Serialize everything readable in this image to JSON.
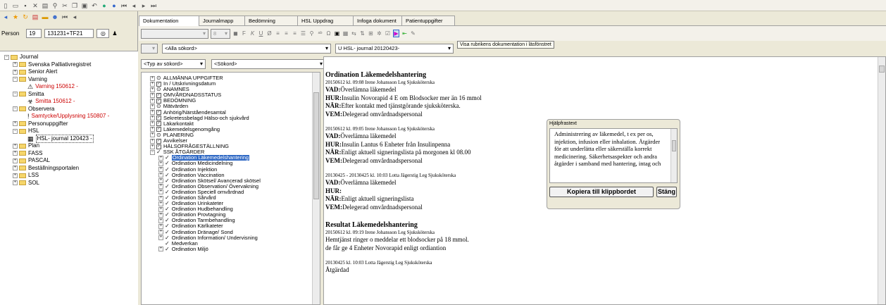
{
  "left": {
    "person_label": "Person",
    "person_num": "19",
    "person_id": "131231+TF21",
    "tree": [
      {
        "label": "Journal",
        "lvl": 0,
        "pm": "−",
        "t": "folder"
      },
      {
        "label": "Svenska Palliativregistret",
        "lvl": 1,
        "pm": "+",
        "t": "folder"
      },
      {
        "label": "Senior Alert",
        "lvl": 1,
        "pm": "+",
        "t": "folder"
      },
      {
        "label": "Varning",
        "lvl": 1,
        "pm": "−",
        "t": "folder"
      },
      {
        "label": "Varning 150612 -",
        "lvl": 2,
        "pm": "",
        "t": "warn",
        "red": true
      },
      {
        "label": "Smitta",
        "lvl": 1,
        "pm": "−",
        "t": "folder"
      },
      {
        "label": "Smitta 150612 -",
        "lvl": 2,
        "pm": "",
        "t": "smitta",
        "red": true
      },
      {
        "label": "Observera",
        "lvl": 1,
        "pm": "−",
        "t": "folder"
      },
      {
        "label": "Samtycke/Upplysning 150807 -",
        "lvl": 2,
        "pm": "",
        "t": "excl",
        "red": true
      },
      {
        "label": "Personuppgifter",
        "lvl": 1,
        "pm": "+",
        "t": "folder"
      },
      {
        "label": "HSL",
        "lvl": 1,
        "pm": "−",
        "t": "folder"
      },
      {
        "label": "HSL- journal 120423 -",
        "lvl": 2,
        "pm": "",
        "t": "doc",
        "boxed": true
      },
      {
        "label": "Plan",
        "lvl": 1,
        "pm": "+",
        "t": "folder"
      },
      {
        "label": "FASS",
        "lvl": 1,
        "pm": "+",
        "t": "folder"
      },
      {
        "label": "PASCAL",
        "lvl": 1,
        "pm": "+",
        "t": "folder"
      },
      {
        "label": "Beställningsportalen",
        "lvl": 1,
        "pm": "+",
        "t": "folder"
      },
      {
        "label": "LSS",
        "lvl": 1,
        "pm": "+",
        "t": "folder"
      },
      {
        "label": "SOL",
        "lvl": 1,
        "pm": "+",
        "t": "folder"
      }
    ]
  },
  "tabs": [
    "Dokumentation",
    "Journalmapp",
    "Bedömning",
    "HSL Uppdrag",
    "Infoga dokument",
    "Patientuppgifter"
  ],
  "toolbar": {
    "font_size": "8",
    "sokord_all": "<Alla sökord>",
    "journal_sel": "U HSL- journal 20120423-",
    "tooltip": "Visa rubrikens dokumentation i läsfönstret"
  },
  "mid": {
    "typ": "<Typ av sökord>",
    "sokord": "<Sökord>",
    "tree": [
      {
        "label": "ALLMÄNNA UPPGIFTER",
        "lvl": 1,
        "pm": "+",
        "i": "o"
      },
      {
        "label": "In / Utskrivningsdatum",
        "lvl": 1,
        "pm": "+",
        "i": "box"
      },
      {
        "label": "ANAMNES",
        "lvl": 1,
        "pm": "+",
        "i": "o"
      },
      {
        "label": "OMVÅRDNADSSTATUS",
        "lvl": 1,
        "pm": "+",
        "i": "box"
      },
      {
        "label": "BEDÖMNING",
        "lvl": 1,
        "pm": "+",
        "i": "box"
      },
      {
        "label": "Mätvärden",
        "lvl": 1,
        "pm": "+",
        "i": "o"
      },
      {
        "label": "Anhörig/Närståendesamtal",
        "lvl": 1,
        "pm": "+",
        "i": "box"
      },
      {
        "label": "Sekretessbelagd Hälso-och sjukvård",
        "lvl": 1,
        "pm": "+",
        "i": "box"
      },
      {
        "label": "Läkarkontakt",
        "lvl": 1,
        "pm": "+",
        "i": "box"
      },
      {
        "label": "Läkemedelsgenomgång",
        "lvl": 1,
        "pm": "+",
        "i": "box"
      },
      {
        "label": "PLANERING",
        "lvl": 1,
        "pm": "+",
        "i": "o"
      },
      {
        "label": "Avvikelser",
        "lvl": 1,
        "pm": "+",
        "i": "box"
      },
      {
        "label": "HÄLSOFRÅGESTÄLLNING",
        "lvl": 1,
        "pm": "+",
        "i": "box"
      },
      {
        "label": "SSK ÅTGÄRDER",
        "lvl": 1,
        "pm": "−",
        "i": "chk"
      },
      {
        "label": "Ordination Läkemedelshantering",
        "lvl": 2,
        "pm": "+",
        "i": "chk",
        "sel": true
      },
      {
        "label": "Ordination Medicindelning",
        "lvl": 2,
        "pm": "+",
        "i": "chk"
      },
      {
        "label": "Ordination Injektion",
        "lvl": 2,
        "pm": "+",
        "i": "chk"
      },
      {
        "label": "Ordination Vaccination",
        "lvl": 2,
        "pm": "+",
        "i": "chk"
      },
      {
        "label": "Ordination Skötsel/ Avancerad skötsel",
        "lvl": 2,
        "pm": "+",
        "i": "chk"
      },
      {
        "label": "Ordination Observation/ Övervakning",
        "lvl": 2,
        "pm": "+",
        "i": "chk"
      },
      {
        "label": "Ordination Speciell omvårdnad",
        "lvl": 2,
        "pm": "+",
        "i": "chk"
      },
      {
        "label": "Ordination Sårvård",
        "lvl": 2,
        "pm": "+",
        "i": "chk"
      },
      {
        "label": "Ordination Urinkateter",
        "lvl": 2,
        "pm": "+",
        "i": "chk"
      },
      {
        "label": "Ordination Hudbehandling",
        "lvl": 2,
        "pm": "+",
        "i": "chk"
      },
      {
        "label": "Ordination Provtagning",
        "lvl": 2,
        "pm": "+",
        "i": "chk"
      },
      {
        "label": "Ordination Tarmbehandling",
        "lvl": 2,
        "pm": "+",
        "i": "chk"
      },
      {
        "label": "Ordination Kärlkateter",
        "lvl": 2,
        "pm": "+",
        "i": "chk"
      },
      {
        "label": "Ordination Dränage/ Sond",
        "lvl": 2,
        "pm": "+",
        "i": "chk"
      },
      {
        "label": "Ordination Information/ Undervisning",
        "lvl": 2,
        "pm": "+",
        "i": "chk"
      },
      {
        "label": "Medverkan",
        "lvl": 2,
        "pm": "",
        "i": "chk"
      },
      {
        "label": "Ordination Miljö",
        "lvl": 2,
        "pm": "+",
        "i": "chk"
      }
    ]
  },
  "doc": {
    "sections": [
      {
        "title": "Ordination Läkemedelshantering",
        "entries": [
          {
            "meta": "20150612 kl. 09:08  Irene Johansson  Leg Sjuksköterska",
            "lines": [
              [
                "VAD:",
                "Överlämna läkemedel"
              ],
              [
                "HUR:",
                "Insulin Novorapid 4 E om Blodsocker mer än 16 mmol"
              ],
              [
                "NÄR:",
                "Efter kontakt med tjänstgörande sjuksköterska."
              ],
              [
                "VEM:",
                "Delegerad omvårdnadspersonal"
              ]
            ]
          },
          {
            "meta": "20150612 kl. 09:05  Irene Johansson  Leg Sjuksköterska",
            "lines": [
              [
                "VAD:",
                "Överlämna läkemedel"
              ],
              [
                "HUR:",
                "Insulin Lantus 6 Enheter  från Insulinpenna"
              ],
              [
                "NÄR:",
                "Enligt aktuell signeringslista på morgonen kl 08.00"
              ],
              [
                "VEM:",
                "Delegerad omvårdnadspersonal"
              ]
            ]
          },
          {
            "meta": "20130425 - 20130425 kl. 10:03  Lotta Jägerstig  Leg Sjuksköterska",
            "lines": [
              [
                "VAD:",
                "Överlämna läkemedel"
              ],
              [
                "HUR:",
                ""
              ],
              [
                "NÄR:",
                "Enligt aktuell signeringslista"
              ],
              [
                "VEM:",
                "Delegerad omvårdnadspersonal"
              ]
            ]
          }
        ]
      },
      {
        "title": "Resultat Läkemedelshantering",
        "entries": [
          {
            "meta": "20150612 kl. 09:19  Irene Johansson  Leg Sjuksköterska",
            "lines": [
              [
                "",
                "Hemtjänst ringer o meddelar ett blodsocker på 18 mmol."
              ],
              [
                "",
                "de får ge 4 Enheter Novorapid enligt ordiantion"
              ]
            ]
          },
          {
            "meta": "20130425 kl. 10:03  Lotta Jägerstig  Leg Sjuksköterska",
            "lines": [
              [
                "",
                "Åtgärdad"
              ]
            ]
          }
        ]
      }
    ]
  },
  "help": {
    "title": "Hjälpfrastext",
    "text": "Administrering av läkemedel, t ex per os, injektion, infusion eller inhalation. Åtgärder för att underlätta eller säkerställa korrekt medicinering. Säkerhetsaspekter och andra åtgärder i samband med hantering, intag och",
    "copy": "Kopiera till klippbordet",
    "close": "Stäng"
  }
}
